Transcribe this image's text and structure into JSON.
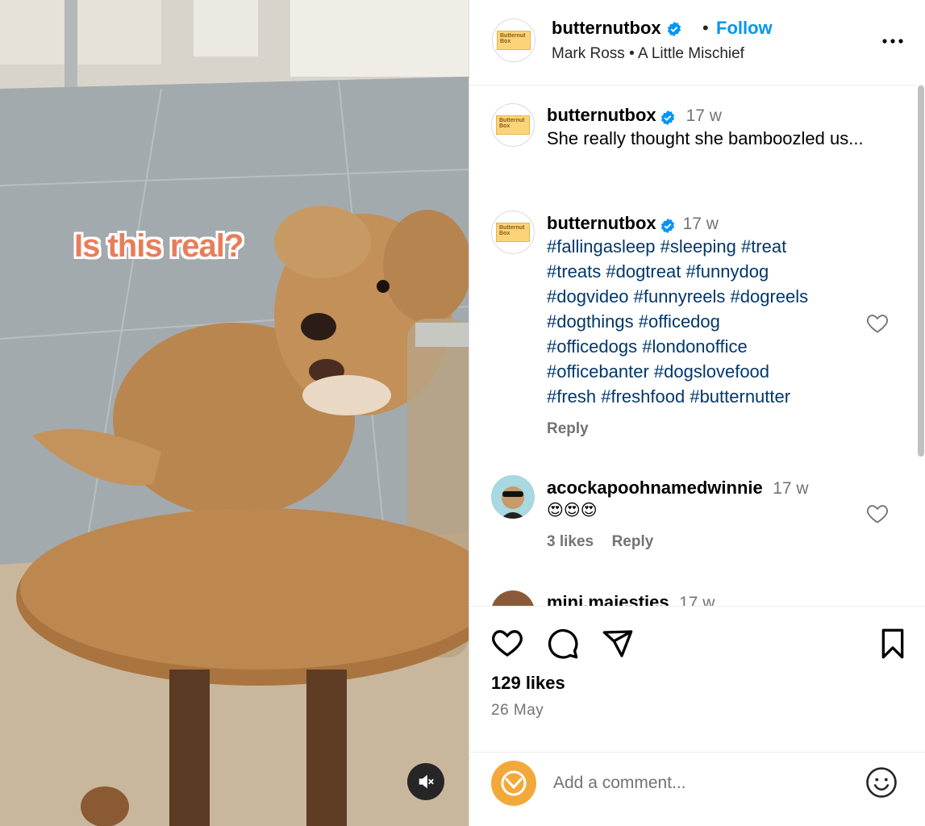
{
  "media": {
    "overlay_caption": "Is this real?",
    "mute_icon": "speaker-muted-icon"
  },
  "header": {
    "username": "butternutbox",
    "verified": true,
    "separator": "•",
    "follow_label": "Follow",
    "subtitle": "Mark Ross • A Little Mischief",
    "avatar_logo_text": "Butternut Box"
  },
  "comments": [
    {
      "username": "butternutbox",
      "time": "17 w",
      "text": "She really thought she bamboozled us..."
    },
    {
      "username": "butternutbox",
      "time": "17 w",
      "hashtags_lines": [
        "#fallingasleep #sleeping #treat",
        "#treats #dogtreat #funnydog",
        "#dogvideo #funnyreels #dogreels",
        "#dogthings #officedog",
        "#officedogs #londonoffice",
        "#officebanter #dogslovefood",
        "#fresh #freshfood #butternutter"
      ],
      "reply_label": "Reply"
    },
    {
      "username": "acockapoohnamedwinnie",
      "time": "17 w",
      "text": "😍😍😍",
      "likes_label": "3 likes",
      "reply_label": "Reply"
    },
    {
      "username": "mini.majesties",
      "time": "17 w"
    }
  ],
  "actions": {
    "likes": "129 likes",
    "date": "26 May"
  },
  "add_comment": {
    "placeholder": "Add a comment..."
  },
  "colors": {
    "link_blue": "#0095f6",
    "hashtag": "#00376b",
    "secondary_text": "#737373",
    "overlay_text": "#e77e5b"
  }
}
